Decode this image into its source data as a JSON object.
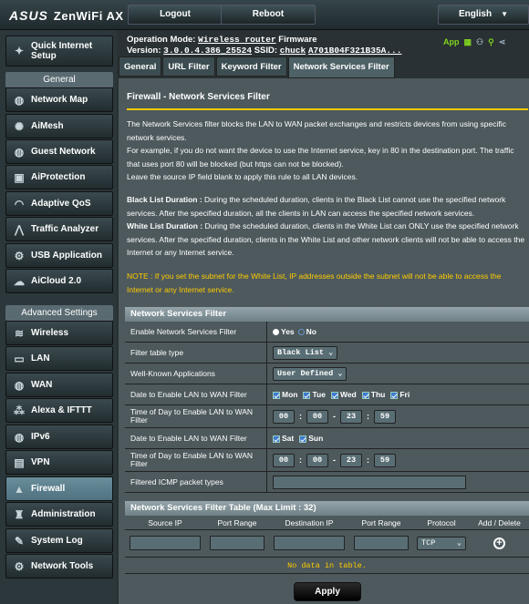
{
  "brand": {
    "logo": "ASUS",
    "product": "ZenWiFi AX"
  },
  "topbar": {
    "logout": "Logout",
    "reboot": "Reboot",
    "language": "English"
  },
  "sidebar": {
    "quick_setup": [
      "Quick Internet",
      "Setup"
    ],
    "general_header": "General",
    "general_items": [
      "Network Map",
      "AiMesh",
      "Guest Network",
      "AiProtection",
      "Adaptive QoS",
      "Traffic Analyzer",
      "USB Application",
      "AiCloud 2.0"
    ],
    "advanced_header": "Advanced Settings",
    "advanced_items": [
      "Wireless",
      "LAN",
      "WAN",
      "Alexa & IFTTT",
      "IPv6",
      "VPN",
      "Firewall",
      "Administration",
      "System Log",
      "Network Tools"
    ],
    "active_item": "Firewall"
  },
  "status": {
    "op_label": "Operation Mode:",
    "op_mode": "Wireless router",
    "firmware_label": "Firmware",
    "version_label": "Version:",
    "version": "3.0.0.4.386_25524",
    "ssid_label": "SSID:",
    "ssid": "chuck",
    "mac": "A701B04F321B35A...",
    "app_label": "App"
  },
  "tabs": [
    "General",
    "URL Filter",
    "Keyword Filter",
    "Network Services Filter"
  ],
  "page": {
    "title": "Firewall - Network Services Filter",
    "desc1": "The Network Services filter blocks the LAN to WAN packet exchanges and restricts devices from using specific network services.",
    "desc2": "For example, if you do not want the device to use the Internet service, key in 80 in the destination port. The traffic that uses port 80 will be blocked (but https can not be blocked).",
    "desc3": "Leave the source IP field blank to apply this rule to all LAN devices.",
    "black_label": "Black List Duration :",
    "black_text": " During the scheduled duration, clients in the Black List cannot use the specified network services. After the specified duration, all the clients in LAN can access the specified network services.",
    "white_label": "White List Duration :",
    "white_text": " During the scheduled duration, clients in the White List can ONLY use the specified network services. After the specified duration, clients in the White List and other network clients will not be able to access the Internet or any Internet service.",
    "note": "NOTE : If you set the subnet for the White List, IP addresses outside the subnet will not be able to access the Internet or any Internet service."
  },
  "filter": {
    "section_title": "Network Services Filter",
    "enable_label": "Enable Network Services Filter",
    "yes": "Yes",
    "no": "No",
    "table_type_label": "Filter table type",
    "table_type_value": "Black List",
    "wk_label": "Well-Known Applications",
    "wk_value": "User Defined",
    "date1_label": "Date to Enable LAN to WAN Filter",
    "weekdays": [
      "Mon",
      "Tue",
      "Wed",
      "Thu",
      "Fri"
    ],
    "time1_label": "Time of Day to Enable LAN to WAN Filter",
    "time1": [
      "00",
      "00",
      "23",
      "59"
    ],
    "date2_label": "Date to Enable LAN to WAN Filter",
    "weekend": [
      "Sat",
      "Sun"
    ],
    "time2_label": "Time of Day to Enable LAN to WAN Filter",
    "time2": [
      "00",
      "00",
      "23",
      "59"
    ],
    "icmp_label": "Filtered ICMP packet types"
  },
  "table": {
    "title": "Network Services Filter Table (Max Limit : 32)",
    "columns": [
      "Source IP",
      "Port Range",
      "Destination IP",
      "Port Range",
      "Protocol",
      "Add / Delete"
    ],
    "protocol_value": "TCP",
    "empty": "No data in table."
  },
  "apply": "Apply",
  "colors": {
    "accent": "#ffcc00",
    "panel": "#4d595d",
    "active": "#5b7f8e"
  }
}
